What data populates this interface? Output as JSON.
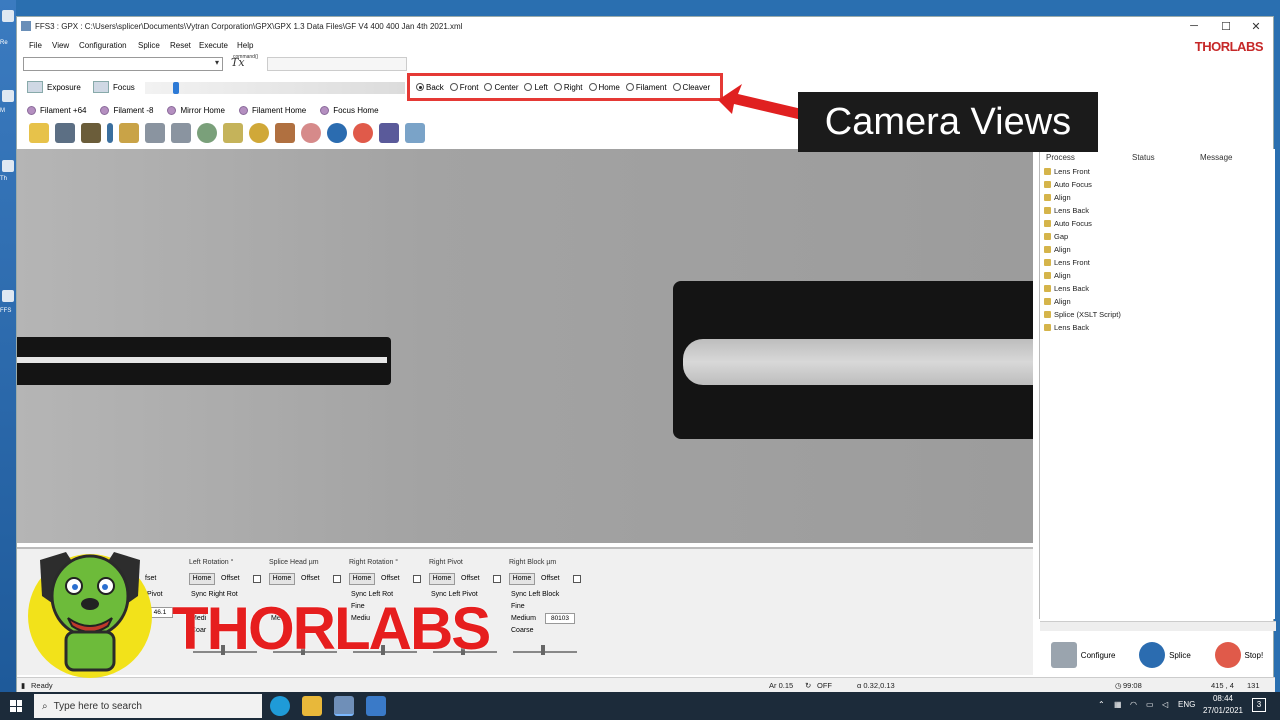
{
  "window": {
    "title": "FFS3 : GPX : C:\\Users\\splicer\\Documents\\Vytran Corporation\\GPX\\GPX 1.3 Data Files\\GF V4 400 400 Jan 4th 2021.xml",
    "brand": "THORLABS",
    "controls": [
      "─",
      "☐",
      "✕"
    ]
  },
  "menu": [
    "File",
    "View",
    "Configuration",
    "Splice",
    "Reset",
    "Execute",
    "Help"
  ],
  "command": {
    "label": "command()",
    "icon": "Tx"
  },
  "toolbar": {
    "exposure": "Exposure",
    "focus": "Focus"
  },
  "camera_views": {
    "options": [
      "Back",
      "Front",
      "Center",
      "Left",
      "Right",
      "Home",
      "Filament",
      "Cleaver"
    ],
    "selected": "Back",
    "callout": "Camera Views"
  },
  "positions": [
    "Filament +64",
    "Filament -8",
    "Mirror Home",
    "Filament Home",
    "Focus Home"
  ],
  "process": {
    "headers": [
      "Process",
      "Status",
      "Message"
    ],
    "items": [
      "Lens Front",
      "Auto Focus",
      "Align",
      "Lens Back",
      "Auto Focus",
      "Gap",
      "Align",
      "Lens Front",
      "Align",
      "Lens Back",
      "Align",
      "Splice (XSLT Script)",
      "Lens Back"
    ],
    "buttons": {
      "configure": "Configure",
      "splice": "Splice",
      "stop": "Stop!"
    }
  },
  "motion_groups": [
    {
      "title": "Left Rotation °",
      "home": "Home",
      "offset": "Offset",
      "sync": "Sync Right Rot",
      "r1": "",
      "r2": "Medi",
      "r3": "Coar",
      "value": ""
    },
    {
      "title": "Splice Head µm",
      "home": "Home",
      "offset": "Offset",
      "sync": "",
      "r1": "",
      "r2": "Me",
      "r3": "",
      "value": ""
    },
    {
      "title": "Right Rotation °",
      "home": "Home",
      "offset": "Offset",
      "sync": "Sync Left Rot",
      "r1": "Fine",
      "r2": "Mediu",
      "r3": "",
      "value": ""
    },
    {
      "title": "Right Pivot",
      "home": "Home",
      "offset": "Offset",
      "sync": "Sync Left Pivot",
      "r1": "",
      "r2": "",
      "r3": "",
      "value": ""
    },
    {
      "title": "Right Block µm",
      "home": "Home",
      "offset": "Offset",
      "sync": "Sync Left Block",
      "r1": "Fine",
      "r2": "Medium",
      "r3": "Coarse",
      "value": "80103"
    }
  ],
  "left_fragments": {
    "offset": "fset",
    "pivot": "Pivot",
    "value": "46.1"
  },
  "status": {
    "ready": "Ready",
    "ar": "Ar 0.15",
    "off": "OFF",
    "alpha": "α 0.32,0.13",
    "time": "99:08",
    "coord": "415 , 4",
    "num": "131"
  },
  "logo_text": "THORLABS",
  "taskbar": {
    "search_placeholder": "Type here to search",
    "lang": "ENG",
    "clock_time": "08:44",
    "clock_date": "27/01/2021",
    "notif": "3"
  },
  "desktop_labels": [
    "Re",
    "M",
    "Th",
    "FFS"
  ]
}
